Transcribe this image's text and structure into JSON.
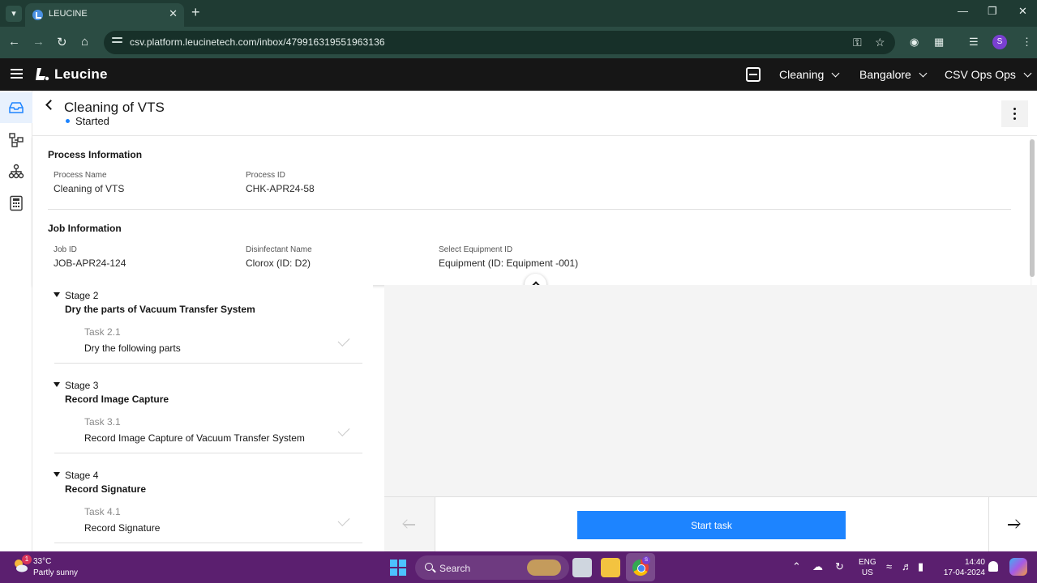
{
  "browser": {
    "tab_title": "LEUCINE",
    "url": "csv.platform.leucinetech.com/inbox/479916319551963136",
    "profile_initial": "S"
  },
  "app": {
    "brand": "Leucine",
    "use_case": "Cleaning",
    "facility": "Bangalore",
    "user": "CSV Ops Ops",
    "accent_color": "#1d84ff"
  },
  "job": {
    "title": "Cleaning of VTS",
    "status": "Started"
  },
  "process_info": {
    "heading": "Process Information",
    "fields": [
      {
        "label": "Process Name",
        "value": "Cleaning of VTS"
      },
      {
        "label": "Process ID",
        "value": "CHK-APR24-58"
      }
    ]
  },
  "job_info": {
    "heading": "Job Information",
    "fields": [
      {
        "label": "Job ID",
        "value": "JOB-APR24-124"
      },
      {
        "label": "Disinfectant Name",
        "value": "Clorox (ID: D2)"
      },
      {
        "label": "Select Equipment ID",
        "value": "Equipment (ID: Equipment -001)"
      }
    ]
  },
  "stages": [
    {
      "label": "Stage 2",
      "name": "Dry the parts of Vacuum Transfer System",
      "task_label": "Task 2.1",
      "task_name": "Dry the following parts"
    },
    {
      "label": "Stage 3",
      "name": "Record Image Capture",
      "task_label": "Task 3.1",
      "task_name": "Record Image Capture of Vacuum Transfer System"
    },
    {
      "label": "Stage 4",
      "name": "Record Signature",
      "task_label": "Task 4.1",
      "task_name": "Record Signature"
    }
  ],
  "footer": {
    "start_label": "Start task"
  },
  "taskbar": {
    "weather_badge": "1",
    "temperature": "33°C",
    "condition": "Partly sunny",
    "search_label": "Search",
    "lang_top": "ENG",
    "lang_bottom": "US",
    "time": "14:40",
    "date": "17-04-2024"
  }
}
